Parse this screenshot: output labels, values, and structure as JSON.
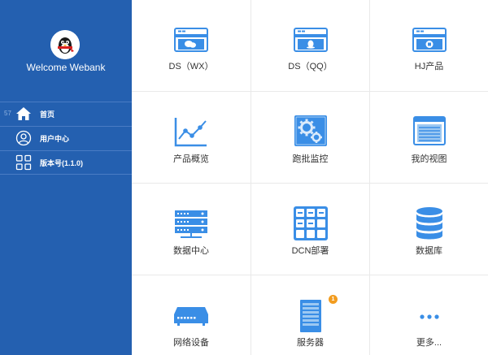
{
  "sidebar": {
    "welcome": "Welcome Webank",
    "items": [
      {
        "prefix": "57",
        "label": "首页",
        "icon": "home-icon"
      },
      {
        "prefix": "",
        "label": "用户中心",
        "icon": "user-icon"
      },
      {
        "prefix": "",
        "label": "版本号(1.1.0)",
        "icon": "grid-icon"
      }
    ]
  },
  "tiles": [
    {
      "label": "DS（WX）",
      "icon": "wechat-card-icon"
    },
    {
      "label": "DS（QQ）",
      "icon": "qq-card-icon"
    },
    {
      "label": "HJ产品",
      "icon": "product-card-icon"
    },
    {
      "label": "产品概览",
      "icon": "line-chart-icon"
    },
    {
      "label": "跑批监控",
      "icon": "gears-icon"
    },
    {
      "label": "我的视图",
      "icon": "view-window-icon"
    },
    {
      "label": "数据中心",
      "icon": "server-rack-icon"
    },
    {
      "label": "DCN部署",
      "icon": "dcn-grid-icon"
    },
    {
      "label": "数据库",
      "icon": "database-icon"
    },
    {
      "label": "网络设备",
      "icon": "network-device-icon"
    },
    {
      "label": "服务器",
      "icon": "server-tower-icon",
      "badge": "1"
    },
    {
      "label": "更多...",
      "icon": "more-dots-icon"
    }
  ],
  "colors": {
    "sidebar_bg": "#2460b0",
    "icon_blue": "#3a8ee6",
    "badge": "#f29c1f"
  }
}
